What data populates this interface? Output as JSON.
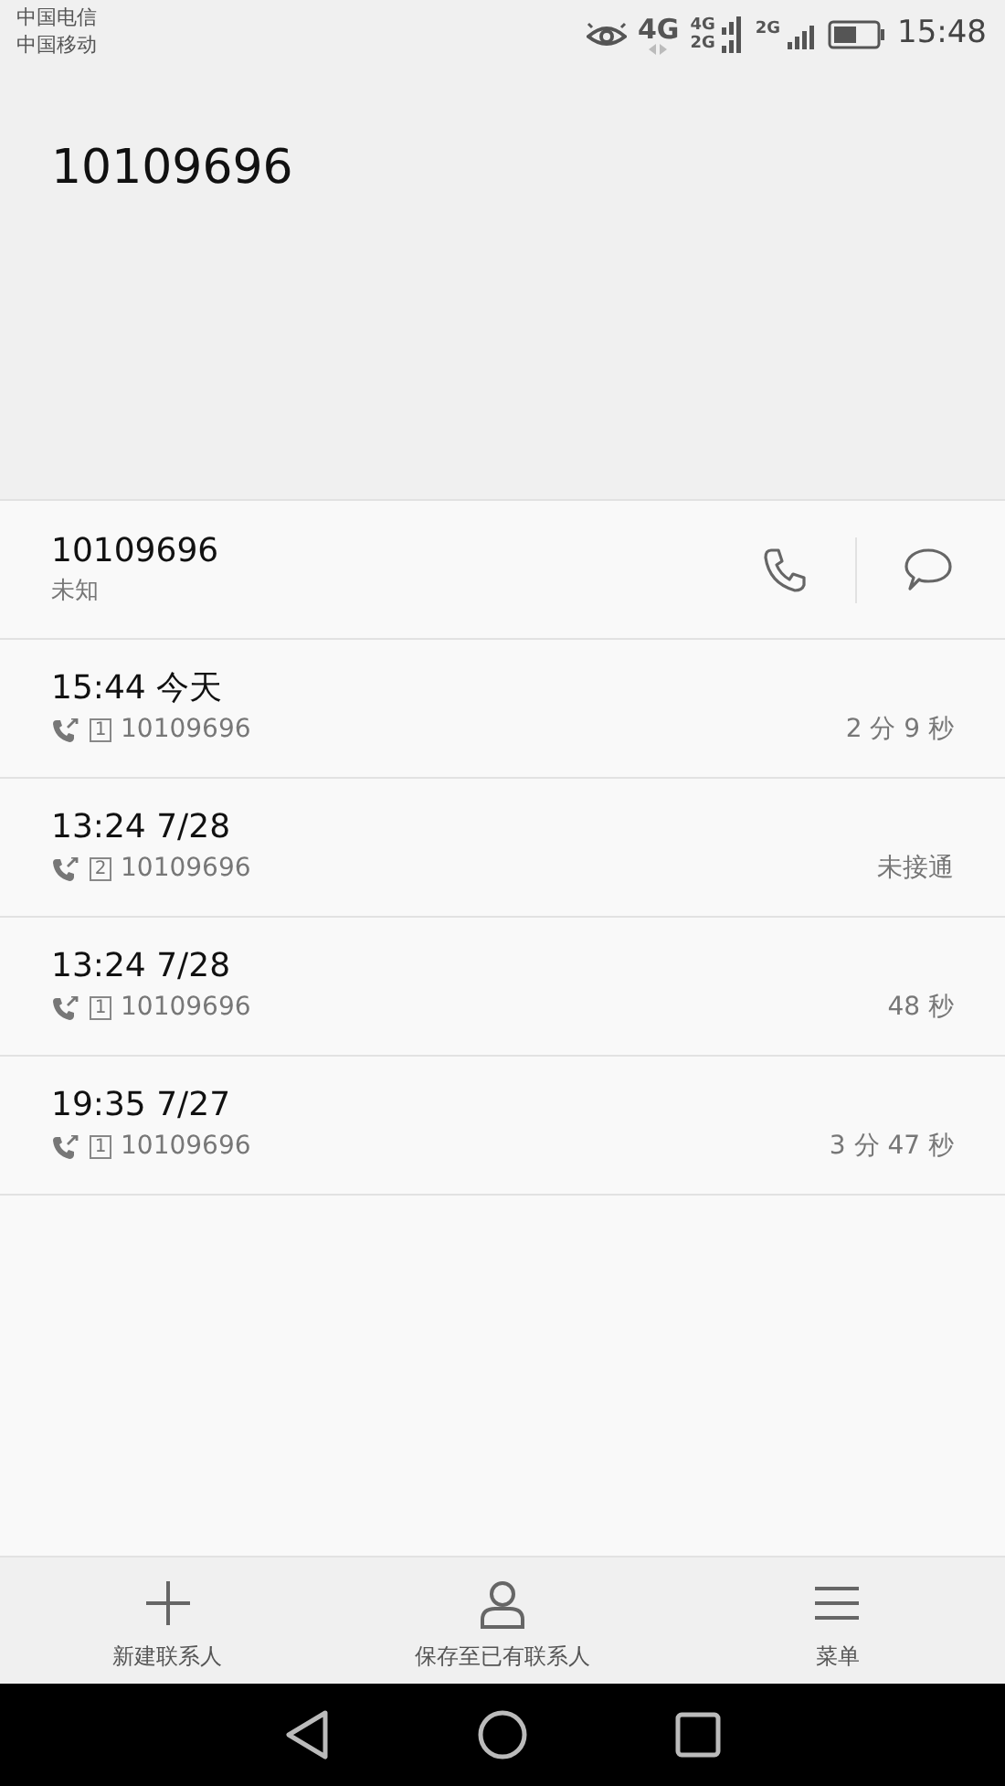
{
  "status_bar": {
    "carriers": [
      "中国电信",
      "中国移动"
    ],
    "network_labels": [
      "4G",
      "4G",
      "2G",
      "2G"
    ],
    "time": "15:48"
  },
  "header": {
    "number": "10109696"
  },
  "contact": {
    "number": "10109696",
    "location": "未知"
  },
  "calls": [
    {
      "time": "15:44 今天",
      "sim": "1",
      "number": "10109696",
      "duration": "2 分 9 秒"
    },
    {
      "time": "13:24 7/28",
      "sim": "2",
      "number": "10109696",
      "duration": "未接通"
    },
    {
      "time": "13:24 7/28",
      "sim": "1",
      "number": "10109696",
      "duration": "48 秒"
    },
    {
      "time": "19:35 7/27",
      "sim": "1",
      "number": "10109696",
      "duration": "3 分 47 秒"
    }
  ],
  "bottom_actions": [
    {
      "label": "新建联系人",
      "kind": "add"
    },
    {
      "label": "保存至已有联系人",
      "kind": "person"
    },
    {
      "label": "菜单",
      "kind": "menu"
    }
  ]
}
